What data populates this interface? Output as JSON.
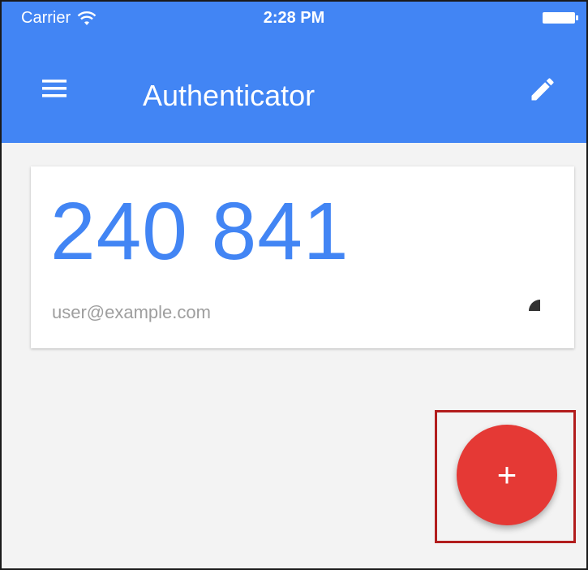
{
  "status_bar": {
    "carrier": "Carrier",
    "time": "2:28 PM",
    "wifi_icon": "wifi-icon",
    "battery_icon": "battery-icon"
  },
  "app_bar": {
    "title": "Authenticator",
    "menu_icon": "menu-icon",
    "edit_icon": "pencil-icon",
    "background": "#4285f4"
  },
  "accounts": [
    {
      "code": "240 841",
      "account": "user@example.com",
      "timer_icon": "countdown-icon"
    }
  ],
  "fab": {
    "icon": "plus-icon",
    "glyph": "+",
    "color": "#e53935"
  },
  "highlight_color": "#b21d1d"
}
